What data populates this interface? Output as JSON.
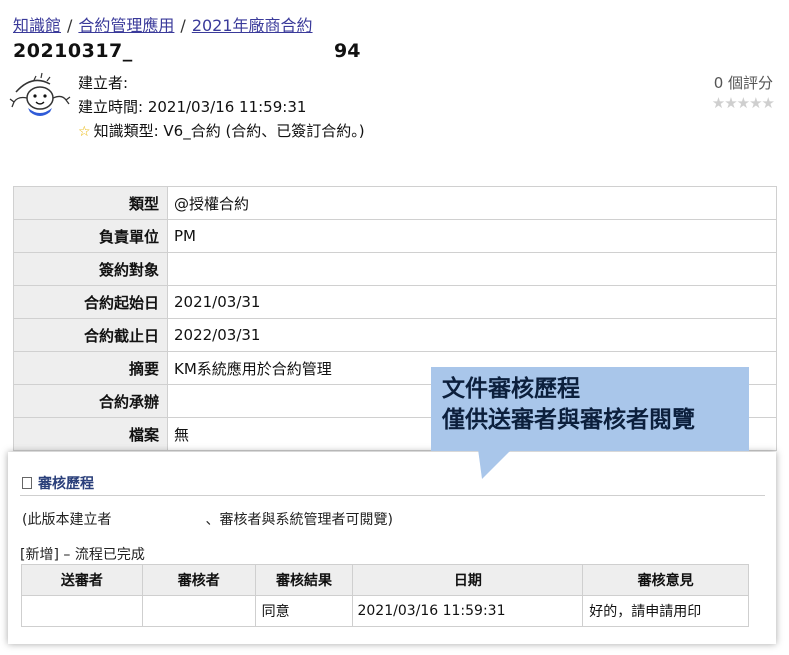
{
  "breadcrumb": {
    "items": [
      "知識館",
      "合約管理應用",
      "2021年廠商合約"
    ],
    "separator": "/"
  },
  "doc": {
    "title": "20210317_",
    "number": "94"
  },
  "meta": {
    "creator_label": "建立者:",
    "created_time": "建立時間: 2021/03/16 11:59:31",
    "knowledge_type": "知識類型: V6_合約 (合約、已簽訂合約。)"
  },
  "rating": {
    "count_text": "0 個評分",
    "stars": "★★★★★",
    "value": 0
  },
  "properties": [
    {
      "label": "類型",
      "value": "@授權合約"
    },
    {
      "label": "負責單位",
      "value": "PM"
    },
    {
      "label": "簽約對象",
      "value": ""
    },
    {
      "label": "合約起始日",
      "value": "2021/03/31"
    },
    {
      "label": "合約截止日",
      "value": "2022/03/31"
    },
    {
      "label": "摘要",
      "value": "KM系統應用於合約管理"
    },
    {
      "label": "合約承辦",
      "value": ""
    },
    {
      "label": "檔案",
      "value": "無"
    }
  ],
  "callout": {
    "line1": "文件審核歷程",
    "line2": "僅供送審者與審核者閱覽"
  },
  "review": {
    "heading": "審核歷程",
    "note_part1": "(此版本建立者",
    "note_part2": "、審核者與系統管理者可閱覽)",
    "status": "[新增] – 流程已完成",
    "columns": [
      "送審者",
      "審核者",
      "審核結果",
      "日期",
      "審核意見"
    ],
    "rows": [
      {
        "submitter": "",
        "reviewer": "",
        "result": "同意",
        "date": "2021/03/16 11:59:31",
        "comment": "好的，請申請用印"
      }
    ]
  },
  "colors": {
    "link": "#3a3a9a",
    "callout_bg": "#a9c6ea",
    "label_bg": "#eeeeee",
    "star_active": "#e8b400",
    "star_inactive": "#cfcfcf"
  },
  "icons": [
    "avatar-doodle",
    "star-icon",
    "document-icon"
  ]
}
